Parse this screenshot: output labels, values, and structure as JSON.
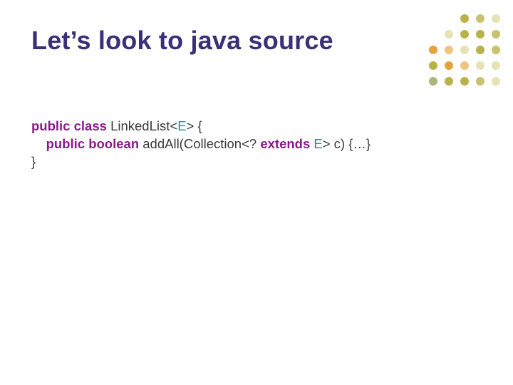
{
  "title": "Let’s look to java source",
  "code": {
    "line1": {
      "kw1": "public",
      "kw2": "class",
      "cls": "LinkedList",
      "lt": "<",
      "gen": "E",
      "gt": ">",
      "open": " {"
    },
    "line2": {
      "indent": "    ",
      "kw1": "public",
      "kw2": "boolean",
      "method": " addAll(Collection",
      "lt": "<",
      "q": "? ",
      "kw3": "extends",
      "sp": " ",
      "gen": "E",
      "gt": ">",
      "rest": " c) {…}"
    },
    "line3": "}"
  },
  "dots": {
    "rows": [
      [
        "olive",
        "khaki",
        "cream"
      ],
      [
        "cream",
        "olive",
        "olive",
        "khaki"
      ],
      [
        "orange",
        "lorange",
        "cream",
        "olive",
        "khaki"
      ],
      [
        "olive",
        "orange",
        "lorange",
        "cream",
        "cream"
      ],
      [
        "sage",
        "olive",
        "olive",
        "khaki",
        "cream"
      ]
    ]
  }
}
